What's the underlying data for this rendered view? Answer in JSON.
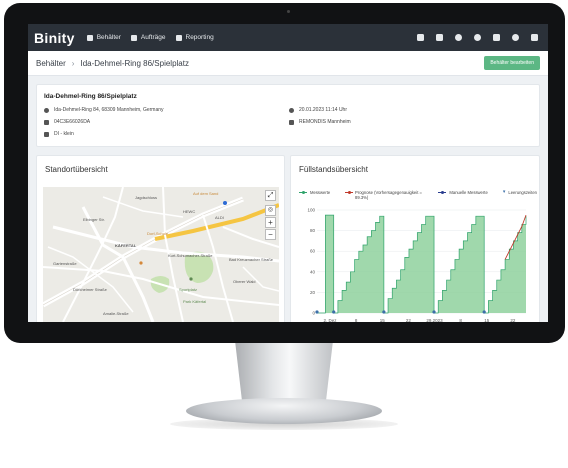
{
  "app": {
    "logo": "Binity"
  },
  "nav": {
    "items": [
      {
        "label": "Behälter",
        "icon": "bin-icon"
      },
      {
        "label": "Aufträge",
        "icon": "list-icon"
      },
      {
        "label": "Reporting",
        "icon": "report-icon"
      }
    ],
    "right_icons": [
      "storage-icon",
      "building-icon",
      "user-icon",
      "location-icon",
      "layers-icon",
      "user-settings-icon",
      "logout-icon"
    ]
  },
  "breadcrumb": {
    "root": "Behälter",
    "separator": "›",
    "current": "Ida-Dehmel-Ring 86/Spielplatz"
  },
  "actions": {
    "edit_label": "Behälter bearbeiten"
  },
  "info": {
    "title": "Ida-Dehmel-Ring 86/Spielplatz",
    "address": "Ida-Dehmel-Ring 84, 68309 Mannheim, Germany",
    "device_id": "04C3E66026DA",
    "type": "DI - klein",
    "timestamp": "20.01.2023 11:14 Uhr",
    "company": "REMONDIS Mannheim"
  },
  "map_panel": {
    "title": "Standortübersicht",
    "zoom_in": "+",
    "zoom_out": "−",
    "labels": {
      "l1": "Jagdschloss",
      "l2": "ALDI",
      "l3": "HEWC",
      "l4": "KÄFERTAL",
      "l5": "Kurt-Schumacher-Straße",
      "l6": "Bad Kreuznacher Straße",
      "l7": "Gartenstraße",
      "l8": "Sportplatz",
      "l9": "Park Käfertal",
      "l10": "Oberer Wald",
      "l11": "Auf dem Sand",
      "l12": "Elbinger Str.",
      "l13": "Dürkheimer Straße",
      "l14": "Amalie-Straße",
      "l15": "Dorf-Schule"
    }
  },
  "chart_panel": {
    "title": "Füllstandsübersicht",
    "legend": {
      "measured": "Messwerte",
      "forecast": "Prognose (Vorhersagegenauigkeit = 89.3%)",
      "manual": "Manuelle Messwerte",
      "emptying": "Leerungszeiten"
    },
    "colors": {
      "measured": "#2fa36b",
      "fill": "#8fd19e",
      "forecast": "#c0392b",
      "manual": "#2a3d8f",
      "emptying": "#3b6fa8"
    }
  },
  "chart_data": {
    "type": "area",
    "title": "Füllstandsübersicht",
    "ylim": [
      0,
      100
    ],
    "yticks": [
      0,
      20,
      40,
      60,
      80,
      100
    ],
    "xticks": [
      "2. Dez",
      "8",
      "15",
      "22",
      "29.2023",
      "8",
      "15",
      "22"
    ],
    "series": [
      {
        "name": "Messwerte",
        "points": [
          [
            0,
            0
          ],
          [
            1,
            95
          ],
          [
            2,
            0
          ],
          [
            2.5,
            12
          ],
          [
            3,
            22
          ],
          [
            3.5,
            30
          ],
          [
            4,
            40
          ],
          [
            4.5,
            52
          ],
          [
            5,
            60
          ],
          [
            5.5,
            66
          ],
          [
            6,
            74
          ],
          [
            6.5,
            80
          ],
          [
            7,
            88
          ],
          [
            7.5,
            94
          ],
          [
            8,
            0
          ],
          [
            8.5,
            14
          ],
          [
            9,
            24
          ],
          [
            9.5,
            32
          ],
          [
            10,
            42
          ],
          [
            10.5,
            54
          ],
          [
            11,
            62
          ],
          [
            11.5,
            70
          ],
          [
            12,
            78
          ],
          [
            12.5,
            86
          ],
          [
            13,
            94
          ],
          [
            14,
            0
          ],
          [
            14.5,
            12
          ],
          [
            15,
            22
          ],
          [
            15.5,
            32
          ],
          [
            16,
            42
          ],
          [
            16.5,
            52
          ],
          [
            17,
            62
          ],
          [
            17.5,
            70
          ],
          [
            18,
            78
          ],
          [
            18.5,
            86
          ],
          [
            19,
            94
          ],
          [
            20,
            0
          ],
          [
            20.5,
            12
          ],
          [
            21,
            22
          ],
          [
            21.5,
            32
          ],
          [
            22,
            42
          ],
          [
            22.5,
            52
          ],
          [
            23,
            62
          ],
          [
            23.5,
            70
          ],
          [
            24,
            78
          ],
          [
            24.5,
            86
          ],
          [
            25,
            94
          ]
        ]
      },
      {
        "name": "Prognose",
        "points": [
          [
            22.5,
            52
          ],
          [
            23.5,
            68
          ],
          [
            24.5,
            84
          ],
          [
            25,
            95
          ]
        ]
      }
    ],
    "emptying_times": [
      0,
      2,
      8,
      14,
      20
    ],
    "x_max": 25
  }
}
